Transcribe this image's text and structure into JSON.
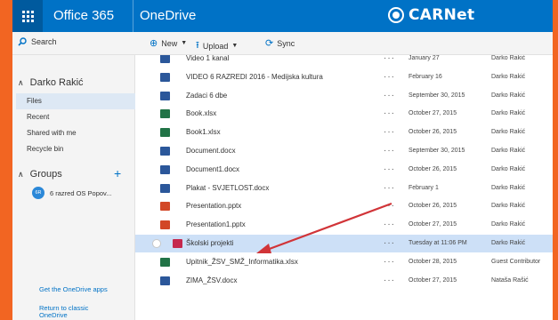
{
  "topbar": {
    "brand": "Office 365",
    "app_name": "OneDrive",
    "logo_text": "CARNet"
  },
  "command_bar": {
    "search_label": "Search",
    "new_label": "New",
    "upload_label": "Upload",
    "sync_label": "Sync"
  },
  "sidebar": {
    "user_name": "Darko Rakić",
    "nav": [
      {
        "label": "Files",
        "selected": true
      },
      {
        "label": "Recent",
        "selected": false
      },
      {
        "label": "Shared with me",
        "selected": false
      },
      {
        "label": "Recycle bin",
        "selected": false
      }
    ],
    "groups_label": "Groups",
    "group_item": {
      "initials": "6R",
      "name": "6 razred OS Popov..."
    },
    "get_apps_link": "Get the OneDrive apps",
    "return_link_line1": "Return to classic",
    "return_link_line2": "OneDrive"
  },
  "files": [
    {
      "name": "Video 1 kanal",
      "date": "January 27",
      "author": "Darko Rakić",
      "icon": "folder-icon",
      "color": "#2b579a",
      "partial": true
    },
    {
      "name": "VIDEO 6 RAZREDI 2016 - Medijska kultura",
      "date": "February 16",
      "author": "Darko Rakić",
      "icon": "folder-icon",
      "color": "#2b579a"
    },
    {
      "name": "Zadaci 6 dbe",
      "date": "September 30, 2015",
      "author": "Darko Rakić",
      "icon": "folder-icon",
      "color": "#2b579a"
    },
    {
      "name": "Book.xlsx",
      "date": "October 27, 2015",
      "author": "Darko Rakić",
      "icon": "excel-icon",
      "color": "#217346"
    },
    {
      "name": "Book1.xlsx",
      "date": "October 26, 2015",
      "author": "Darko Rakić",
      "icon": "excel-icon",
      "color": "#217346"
    },
    {
      "name": "Document.docx",
      "date": "September 30, 2015",
      "author": "Darko Rakić",
      "icon": "word-icon",
      "color": "#2b579a"
    },
    {
      "name": "Document1.docx",
      "date": "October 26, 2015",
      "author": "Darko Rakić",
      "icon": "word-icon",
      "color": "#2b579a"
    },
    {
      "name": "Plakat - SVJETLOST.docx",
      "date": "February 1",
      "author": "Darko Rakić",
      "icon": "word-icon",
      "color": "#2b579a"
    },
    {
      "name": "Presentation.pptx",
      "date": "October 26, 2015",
      "author": "Darko Rakić",
      "icon": "powerpoint-icon",
      "color": "#d24726"
    },
    {
      "name": "Presentation1.pptx",
      "date": "October 27, 2015",
      "author": "Darko Rakić",
      "icon": "powerpoint-icon",
      "color": "#d24726"
    },
    {
      "name": "Školski projekti",
      "date": "Tuesday at 11:06 PM",
      "author": "Darko Rakić",
      "icon": "onenote-icon",
      "color": "#c5284d",
      "selected": true
    },
    {
      "name": "Upitnik_ŽSV_SMŽ_Informatika.xlsx",
      "date": "October 28, 2015",
      "author": "Guest Contributor",
      "icon": "excel-icon",
      "color": "#217346"
    },
    {
      "name": "ZIMA_ŽSV.docx",
      "date": "October 27, 2015",
      "author": "Nataša Rašić",
      "icon": "word-icon",
      "color": "#2b579a"
    }
  ],
  "colors": {
    "frame": "#f26522",
    "suite_bar": "#0072c6",
    "selected_row": "#cde0f7",
    "annotation_arrow": "#d13438"
  }
}
